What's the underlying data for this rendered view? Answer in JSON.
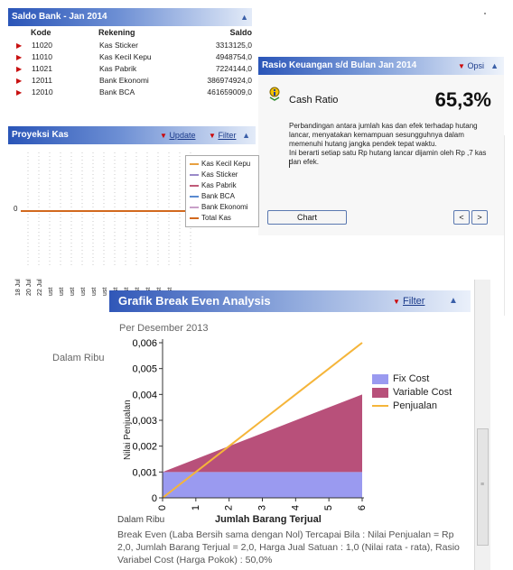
{
  "saldo": {
    "title": "Saldo Bank - Jan 2014",
    "collapse": "▲",
    "headers": {
      "kode": "Kode",
      "rekening": "Rekening",
      "saldo": "Saldo"
    },
    "rows": [
      {
        "kode": "11020",
        "rekening": "Kas Sticker",
        "saldo": "3313125,0"
      },
      {
        "kode": "11010",
        "rekening": "Kas Kecil Kepu",
        "saldo": "4948754,0"
      },
      {
        "kode": "11021",
        "rekening": "Kas Pabrik",
        "saldo": "7224144,0"
      },
      {
        "kode": "12011",
        "rekening": "Bank Ekonomi",
        "saldo": "386974924,0"
      },
      {
        "kode": "12010",
        "rekening": "Bank BCA",
        "saldo": "461659009,0"
      }
    ]
  },
  "ratio": {
    "title": "Rasio Keuangan s/d Bulan Jan 2014",
    "opsi": "Opsi",
    "collapse": "▲",
    "name": "Cash Ratio",
    "value": "65,3%",
    "description": "Perbandingan antara jumlah kas dan efek terhadap hutang lancar, menyatakan kemampuan sesungguhnya dalam memenuhi hutang jangka pendek tepat waktu.\nIni berarti setiap satu Rp  hutang lancar dijamin oleh Rp ,7 kas dan efek.",
    "chart_button": "Chart",
    "prev": "<",
    "next": ">"
  },
  "proyeksi": {
    "title": "Proyeksi Kas",
    "update": "Update",
    "filter": "Filter",
    "collapse": "▲",
    "zero_label": "0",
    "legend": [
      {
        "label": "Kas Kecil Kepu",
        "color": "#e8a040"
      },
      {
        "label": "Kas Sticker",
        "color": "#9a8ac8"
      },
      {
        "label": "Kas Pabrik",
        "color": "#c05a78"
      },
      {
        "label": "Bank BCA",
        "color": "#5a8ad0"
      },
      {
        "label": "Bank Ekonomi",
        "color": "#c8a0c8"
      },
      {
        "label": "Total Kas",
        "color": "#d2691e"
      }
    ],
    "dates": [
      "18 Jul",
      "20 Jul",
      "22 Jul",
      "ust",
      "ust",
      "ust",
      "ust",
      "ust",
      "ust",
      "ust",
      "ust",
      "ust",
      "ust",
      "ust",
      "ust"
    ]
  },
  "breakeven": {
    "title": "Grafik Break Even Analysis",
    "filter": "Filter",
    "collapse": "▲",
    "period": "Per Desember 2013",
    "unit_label_top": "Dalam Ribu",
    "unit_label_bottom": "Dalam Ribu",
    "note": "Break Even (Laba Bersih sama dengan Nol) Tercapai Bila : Nilai Penjualan = Rp 2,0, Jumlah Barang Terjual = 2,0, Harga Jual Satuan : 1,0 (Nilai rata - rata), Rasio Variabel Cost (Harga Pokok) : 50,0%"
  },
  "chart_data": {
    "type": "area",
    "xlabel": "Jumlah Barang Terjual",
    "ylabel": "Nilai Penjualan",
    "x": [
      0,
      1,
      2,
      3,
      4,
      5,
      6
    ],
    "xlim": [
      0,
      6
    ],
    "ylim": [
      0,
      0.006
    ],
    "x_ticks": [
      "0",
      "1",
      "2",
      "3",
      "4",
      "5",
      "6"
    ],
    "y_ticks": [
      "0",
      "0,001",
      "0,002",
      "0,003",
      "0,004",
      "0,005",
      "0,006"
    ],
    "series": [
      {
        "name": "Fix Cost",
        "color": "#9a9af0",
        "values": [
          0.001,
          0.001,
          0.001,
          0.001,
          0.001,
          0.001,
          0.001
        ]
      },
      {
        "name": "Variable Cost",
        "color": "#b8507a",
        "values": [
          0.001,
          0.0015,
          0.002,
          0.0025,
          0.003,
          0.0035,
          0.004
        ]
      },
      {
        "name": "Penjualan",
        "color": "#f5b53a",
        "values": [
          0,
          0.001,
          0.002,
          0.003,
          0.004,
          0.005,
          0.006
        ]
      }
    ]
  }
}
